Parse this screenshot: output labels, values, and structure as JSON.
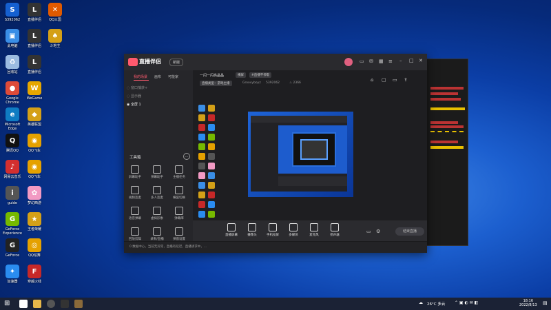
{
  "desktop": {
    "icons": [
      {
        "id": "a",
        "label": "S392062",
        "glyph": "S",
        "color": "#1560d0"
      },
      {
        "id": "b",
        "label": "此电脑",
        "glyph": "▣",
        "color": "#3a8ee6"
      },
      {
        "id": "c",
        "label": "回收站",
        "glyph": "♻",
        "color": "#9bbbe0"
      },
      {
        "id": "d",
        "label": "Google Chrome",
        "glyph": "●",
        "color": "#dd4b39"
      },
      {
        "id": "e",
        "label": "Microsoft Edge",
        "glyph": "e",
        "color": "#0f7cc2"
      },
      {
        "id": "f",
        "label": "腾讯QQ",
        "glyph": "Q",
        "color": "#111"
      },
      {
        "id": "g",
        "label": "网易云音乐",
        "glyph": "♪",
        "color": "#d32f2f"
      },
      {
        "id": "h",
        "label": "guide",
        "glyph": "i",
        "color": "#555"
      },
      {
        "id": "i",
        "label": "GeForce Experience",
        "glyph": "G",
        "color": "#76b900"
      },
      {
        "id": "j",
        "label": "GeForce",
        "glyph": "G",
        "color": "#222"
      },
      {
        "id": "k",
        "label": "加速器",
        "glyph": "✦",
        "color": "#2a8cf0"
      },
      {
        "id": "l",
        "label": "直播伴侣",
        "glyph": "L",
        "color": "#333"
      },
      {
        "id": "m",
        "label": "直播伴侣",
        "glyph": "L",
        "color": "#333"
      },
      {
        "id": "n",
        "label": "直播伴侣",
        "glyph": "L",
        "color": "#333"
      },
      {
        "id": "o",
        "label": "WeGame",
        "glyph": "W",
        "color": "#e6a700"
      },
      {
        "id": "p",
        "label": "英雄联盟",
        "glyph": "◆",
        "color": "#d4a017"
      },
      {
        "id": "q",
        "label": "QQ飞车",
        "glyph": "◉",
        "color": "#e5a100"
      },
      {
        "id": "r",
        "label": "QQ飞车",
        "glyph": "◉",
        "color": "#e5a100"
      },
      {
        "id": "s",
        "label": "梦幻西游",
        "glyph": "✿",
        "color": "#f29ac3"
      },
      {
        "id": "t",
        "label": "王者荣耀",
        "glyph": "★",
        "color": "#d4a017"
      },
      {
        "id": "u",
        "label": "QQ炫舞",
        "glyph": "◎",
        "color": "#e5a100"
      },
      {
        "id": "v",
        "label": "穿越火线",
        "glyph": "F",
        "color": "#c62828"
      },
      {
        "id": "w",
        "label": "QQ三国",
        "glyph": "✕",
        "color": "#e05a00"
      },
      {
        "id": "x",
        "label": "斗地主",
        "glyph": "♠",
        "color": "#d4a017"
      }
    ]
  },
  "app": {
    "title": "直播伴侣",
    "badge": "新版",
    "left_tabs": [
      "我的场景",
      "画布",
      "可能家"
    ],
    "scene_items": [
      "窗口捕获+",
      "显示器",
      "全屏 1"
    ],
    "tools_title": "工具箱",
    "tools": [
      [
        "屏幕助手",
        "弹幕助手",
        "主播任务"
      ],
      [
        "视频连麦",
        "多人连麦",
        "横竖切换"
      ],
      [
        "语音弹幕",
        "虚拟形象",
        "弹幕库"
      ],
      [
        "回放剪辑",
        "录制/直播",
        "弹窗设置"
      ]
    ],
    "header": {
      "stream_title": "一闪一闪亮晶晶",
      "tag": "横屏",
      "tag2": "#直播不停歇",
      "category": "直播类型：游戏主播",
      "user": "Groovyboyz",
      "id": "5392062",
      "fans": "2366"
    },
    "bottom_items": [
      "直播屏幕",
      "摄像头",
      "手机投屏",
      "多媒体",
      "麦克风",
      "扬声器"
    ],
    "start_label": "结束直播",
    "status_text": "0 数据中心，当前无异常，直播有延迟，直播请求中，..."
  },
  "taskbar": {
    "weather": "26°C 多云",
    "time": "18:16",
    "date": "2022/8/13"
  },
  "colors": {
    "accent": "#ff5a6e",
    "desktop": "#0b3ea6"
  }
}
